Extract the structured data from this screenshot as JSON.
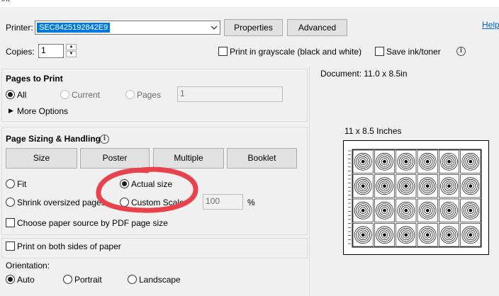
{
  "window": {
    "title_fragment": "int"
  },
  "printer": {
    "label": "Printer:",
    "selected": "SEC8425192842E9",
    "properties_label": "Properties",
    "advanced_label": "Advanced",
    "help_label": "Help"
  },
  "copies": {
    "label": "Copies:",
    "value": "1",
    "grayscale_label": "Print in grayscale (black and white)",
    "grayscale_checked": false,
    "save_ink_label": "Save ink/toner",
    "save_ink_checked": false
  },
  "pages_to_print": {
    "heading": "Pages to Print",
    "options": [
      "All",
      "Current",
      "Pages"
    ],
    "selected": "All",
    "pages_value": "1",
    "more_options_label": "More Options"
  },
  "page_sizing": {
    "heading": "Page Sizing & Handling",
    "tabs": [
      "Size",
      "Poster",
      "Multiple",
      "Booklet"
    ],
    "options": [
      "Fit",
      "Actual size",
      "Shrink oversized pages",
      "Custom Scale:"
    ],
    "selected": "Actual size",
    "custom_scale_value": "100",
    "percent_sign": "%",
    "paper_source_label": "Choose paper source by PDF page size",
    "paper_source_checked": false
  },
  "duplex": {
    "label": "Print on both sides of paper",
    "checked": false
  },
  "orientation": {
    "label": "Orientation:",
    "options": [
      "Auto",
      "Portrait",
      "Landscape"
    ],
    "selected": "Auto"
  },
  "preview": {
    "document_label": "Document: 11.0 x 8.5in",
    "page_size_label": "11 x 8.5 Inches",
    "target_rows": 4,
    "target_cols": 6
  },
  "annotation": {
    "color": "#e8434d",
    "shape": "hand-drawn circle around Actual size and Custom Scale"
  },
  "colors": {
    "selection": "#0078d7",
    "link": "#0066cc",
    "panel": "#f0f0f0"
  }
}
